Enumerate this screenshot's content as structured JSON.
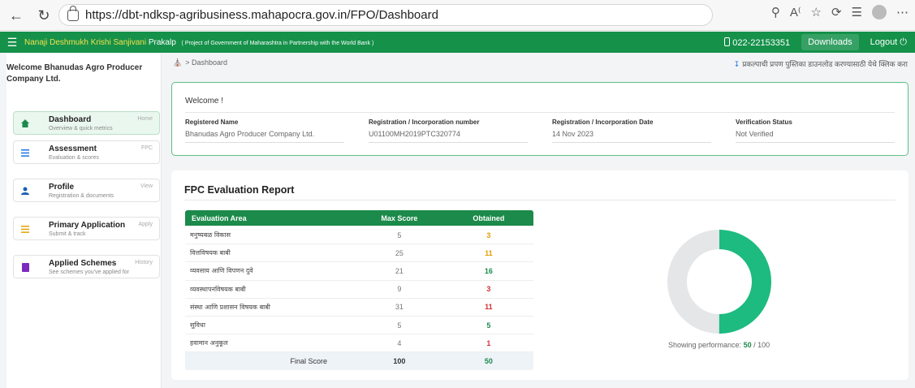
{
  "browser": {
    "url": "https://dbt-ndksp-agribusiness.mahapocra.gov.in/FPO/Dashboard"
  },
  "app_bar": {
    "brand": "Nanaji Deshmukh Krishi Sanjivani",
    "brand_tail": " Prakalp",
    "subtitle": "( Project of Government of Maharashtra in Partnership with the World Bank )",
    "phone": "022-22153351",
    "downloads_label": "Downloads",
    "logout_label": "Logout ⏻"
  },
  "sidebar": {
    "welcome": "Welcome Bhanudas Agro Producer Company Ltd.",
    "items": [
      {
        "label": "Dashboard",
        "sub": "Overview & quick metrics",
        "hint": "Home",
        "icon": "home-icon"
      },
      {
        "label": "Assessment",
        "sub": "Evaluation & scores",
        "hint": "FPC",
        "icon": "list-icon"
      },
      {
        "label": "Profile",
        "sub": "Registration & documents",
        "hint": "View",
        "icon": "user-icon"
      },
      {
        "label": "Primary Application",
        "sub": "Submit & track",
        "hint": "Apply",
        "icon": "menu-icon"
      },
      {
        "label": "Applied Schemes",
        "sub": "See schemes you've applied for",
        "hint": "History",
        "icon": "bookmark-icon"
      }
    ]
  },
  "breadcrumb": {
    "current": "Dashboard"
  },
  "download_note": "प्रकल्पाची प्रपण पुस्तिका डाउनलोड करण्यासाठी येथे क्लिक करा",
  "welcome_card": {
    "title": "Welcome !",
    "fields": [
      {
        "label": "Registered Name",
        "value": "Bhanudas Agro Producer Company Ltd."
      },
      {
        "label": "Registration / Incorporation number",
        "value": "U01100MH2019PTC320774"
      },
      {
        "label": "Registration / Incorporation Date",
        "value": "14 Nov 2023"
      },
      {
        "label": "Verification Status",
        "value": "Not Verified"
      }
    ]
  },
  "report": {
    "title": "FPC Evaluation Report",
    "columns": [
      "Evaluation Area",
      "Max Score",
      "Obtained"
    ],
    "rows": [
      {
        "area": "मनुष्यबळ विकास",
        "max": "5",
        "obtained": "3",
        "color": "#e69b00"
      },
      {
        "area": "वित्तविषयक बाबी",
        "max": "25",
        "obtained": "11",
        "color": "#e69b00"
      },
      {
        "area": "व्यवसाय आणि विपणन दुवे",
        "max": "21",
        "obtained": "16",
        "color": "#1c8a4a"
      },
      {
        "area": "व्यवस्थापनविषयक बाबी",
        "max": "9",
        "obtained": "3",
        "color": "#d32f2f"
      },
      {
        "area": "संस्था आणि प्रशासन विषयक बाबी",
        "max": "31",
        "obtained": "11",
        "color": "#d32f2f"
      },
      {
        "area": "सुविधा",
        "max": "5",
        "obtained": "5",
        "color": "#1c8a4a"
      },
      {
        "area": "हवामान अनुकूल",
        "max": "4",
        "obtained": "1",
        "color": "#d32f2f"
      }
    ],
    "final_label": "Final Score",
    "final_max": "100",
    "final_obtained": "50",
    "performance_label": "Showing performance:",
    "performance_obtained": "50",
    "performance_total": "/ 100",
    "performance_fraction": 0.5,
    "donut_color": "#1dbb7f",
    "donut_track": "#e4e6e8"
  }
}
